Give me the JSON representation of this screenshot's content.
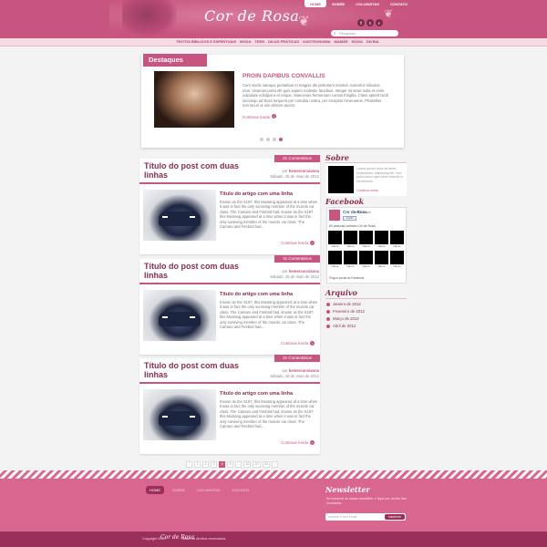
{
  "header": {
    "logo": "Cor de Rosa",
    "topnav": [
      "HOME",
      "SOBRE",
      "COLUNISTAS",
      "CONTATO"
    ],
    "social": [
      "f",
      "t",
      "r"
    ],
    "search_placeholder": "Pesquisar..."
  },
  "categories": [
    "TEXTOS BÍBLICOS E ESPIRITUAIS",
    "MODA",
    "TEEN",
    "DICAS PRÁTICAS",
    "GASTRONOMIA",
    "MAMÃE",
    "NOIVA",
    "DIVINA"
  ],
  "featured": {
    "tag": "Destaques",
    "title": "PROIN DAPIBUS CONVALLIS",
    "text": "Cum sociis natoque penatibus et magnis dis parturient montes, nascetur ridiculus mus. Vivamus porta elit quis sapien molestie faucibus. Integer sit amet nulla et enim vulputate volutpat a et neque. Maecenas fermentum cursus fringilla. Class aptent taciti sociosqu ad litora torquent per conubia nostra, per inceptos himenaeos. Phasellus non lacus ut nisi ultrices auctor.",
    "more": "Continue lendo",
    "dots": [
      false,
      false,
      false,
      true
    ]
  },
  "posts": [
    {
      "title": "Título do post com duas linhas",
      "comments": "31 Comentários",
      "author_prefix": "por",
      "author": "hemersonvianna",
      "date": "Sábado, 26 de maio de 2012",
      "subtitle": "Título do artigo com uma linha",
      "text": "Known as the S197, this Mustang appeared at a time when it was in fact the only surviving member of the muscle car class. The Camaro and Firebird had, known as the S197, this Mustang appeared at a time when it was in fact the only surviving member of the muscle car class. The Camaro and Firebird had...",
      "more": "Continue lendo"
    },
    {
      "title": "Título do post com duas linhas",
      "comments": "31 Comentários",
      "author_prefix": "por",
      "author": "hemersonvianna",
      "date": "Sábado, 26 de maio de 2012",
      "subtitle": "Título do artigo com uma linha",
      "text": "Known as the S197, this Mustang appeared at a time when it was in fact the only surviving member of the muscle car class. The Camaro and Firebird had, known as the S197, this Mustang appeared at a time when it was in fact the only surviving member of the muscle car class. The Camaro and Firebird had...",
      "more": "Continue lendo"
    },
    {
      "title": "Título do post com duas linhas",
      "comments": "31 Comentários",
      "author_prefix": "por",
      "author": "hemersonvianna",
      "date": "Sábado, 26 de maio de 2012",
      "subtitle": "Título do artigo com uma linha",
      "text": "Known as the S197, this Mustang appeared at a time when it was in fact the only surviving member of the muscle car class. The Camaro and Firebird had, known as the S197, this Mustang appeared at a time when it was in fact the only surviving member of the muscle car class. The Camaro and Firebird had...",
      "more": "Continue lendo"
    }
  ],
  "pagination": [
    "‹",
    "1",
    "2",
    "3",
    "4",
    "5",
    "...",
    "10",
    "20",
    "30",
    "›"
  ],
  "pagination_active": "4",
  "sidebar": {
    "sobre": {
      "heading": "Sobre",
      "text": "Lorem ipsum dolor sit amet, consectetur adipiscing elit. Sed porta tortor eget lorem blandit in elementum.",
      "more": "Continue lendo"
    },
    "facebook": {
      "heading": "Facebook",
      "page_name": "Cor de Rosa",
      "page_link": "no Facebook",
      "like": "Curtir",
      "count": "84 pessoas curtiram Cor de Rosa.",
      "names": [
        "Name",
        "Name",
        "Name",
        "Name",
        "Name",
        "Name",
        "Name",
        "Name",
        "Name",
        "Name"
      ],
      "plugin": "Plug-in social do Facebook"
    },
    "arquivo": {
      "heading": "Arquivo",
      "items": [
        "Janeiro de 2012",
        "Fevereiro de 2012",
        "Março de 2012",
        "Abril de 2012"
      ]
    }
  },
  "footer": {
    "nav": [
      "HOME",
      "SOBRE",
      "COLUNISTAS",
      "CONTATO"
    ],
    "newsletter_heading": "Newsletter",
    "newsletter_text": "Se inscreva na nossa newsletter e fique por dentro das novidades.",
    "email_placeholder": "informe o seu email",
    "subscribe": "inscrever",
    "copyright": "Copyright 2012",
    "copy_logo": "Cor de Rosa",
    "rights": "Todos os direitos reservados."
  },
  "colors": {
    "accent": "#c8557f",
    "dark": "#8a2c53",
    "footer": "#d8668f",
    "bottom": "#9a2f5a"
  }
}
